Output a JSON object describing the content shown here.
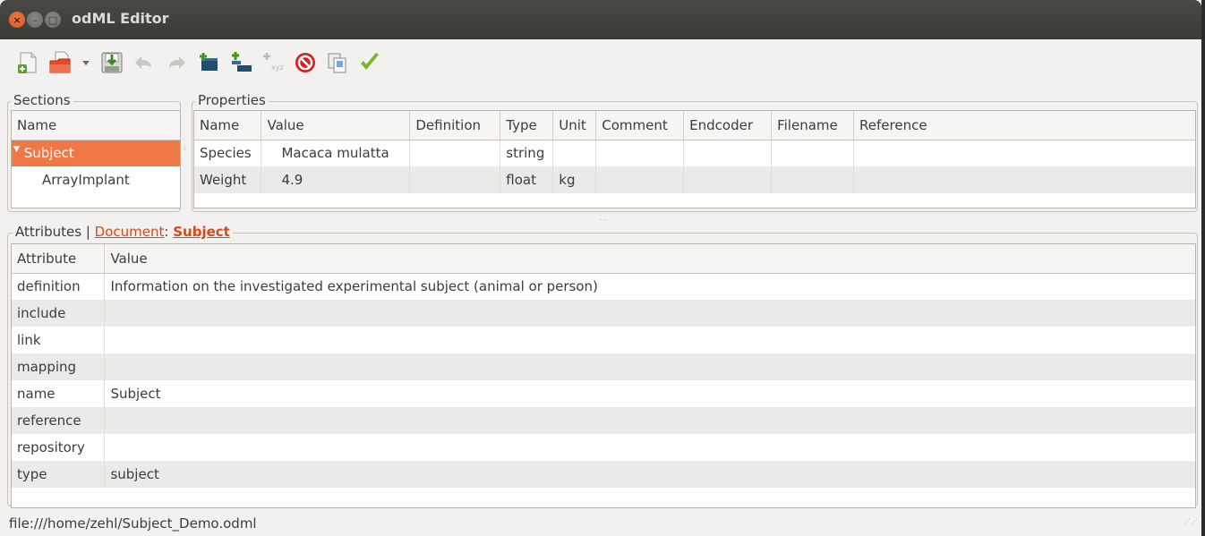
{
  "window": {
    "title": "odML Editor"
  },
  "toolbar": {
    "buttons": [
      {
        "name": "new-document-button",
        "icon": "new-document-icon"
      },
      {
        "name": "open-document-button",
        "icon": "open-folder-icon"
      },
      {
        "name": "recent-dropdown-button",
        "icon": "dropdown-arrow-icon"
      },
      {
        "name": "save-button",
        "icon": "save-icon"
      },
      {
        "name": "undo-button",
        "icon": "undo-icon"
      },
      {
        "name": "redo-button",
        "icon": "redo-icon"
      },
      {
        "name": "add-section-button",
        "icon": "add-section-icon"
      },
      {
        "name": "add-subsection-button",
        "icon": "add-subsection-icon"
      },
      {
        "name": "add-value-button",
        "icon": "add-value-icon"
      },
      {
        "name": "delete-button",
        "icon": "delete-icon"
      },
      {
        "name": "clone-button",
        "icon": "clone-icon"
      },
      {
        "name": "validate-button",
        "icon": "validate-checkmark-icon"
      }
    ],
    "value_button_label": "xyz"
  },
  "sections": {
    "label": "Sections",
    "column": "Name",
    "items": [
      {
        "label": "Subject",
        "selected": true,
        "expanded": true
      },
      {
        "label": "ArrayImplant",
        "selected": false
      }
    ]
  },
  "properties": {
    "label": "Properties",
    "columns": [
      "Name",
      "Value",
      "Definition",
      "Type",
      "Unit",
      "Comment",
      "Endcoder",
      "Filename",
      "Reference"
    ],
    "rows": [
      [
        "Species",
        "Macaca mulatta",
        "",
        "string",
        "",
        "",
        "",
        "",
        ""
      ],
      [
        "Weight",
        "4.9",
        "",
        "float",
        "kg",
        "",
        "",
        "",
        ""
      ]
    ]
  },
  "attributes": {
    "label_prefix": "Attributes |",
    "link_document": "Document",
    "separator": ":",
    "link_current": "Subject",
    "columns": [
      "Attribute",
      "Value"
    ],
    "rows": [
      [
        "definition",
        "Information on the investigated experimental subject (animal or person)"
      ],
      [
        "include",
        ""
      ],
      [
        "link",
        ""
      ],
      [
        "mapping",
        ""
      ],
      [
        "name",
        "Subject"
      ],
      [
        "reference",
        ""
      ],
      [
        "repository",
        ""
      ],
      [
        "type",
        "subject"
      ]
    ]
  },
  "status": {
    "text": "file:///home/zehl/Subject_Demo.odml"
  },
  "colors": {
    "selection": "#f07746",
    "link": "#dd4814",
    "titlebar": "#3c3b37"
  }
}
